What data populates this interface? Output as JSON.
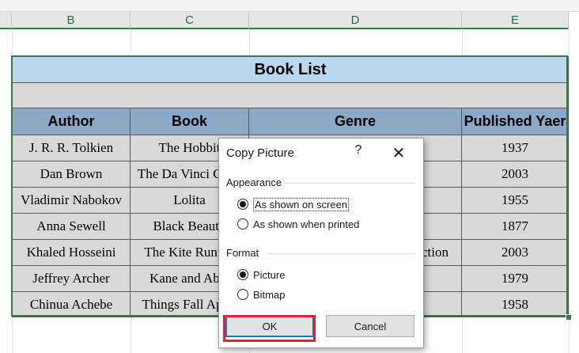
{
  "columns": [
    "B",
    "C",
    "D",
    "E"
  ],
  "table": {
    "title": "Book List",
    "headers": [
      "Author",
      "Book",
      "Genre",
      "Published Yaer"
    ],
    "rows": [
      [
        "J. R. R. Tolkien",
        "The Hobbit",
        "",
        "1937"
      ],
      [
        "Dan Brown",
        "The Da Vinci Code",
        "",
        "2003"
      ],
      [
        "Vladimir Nabokov",
        "Lolita",
        "",
        "1955"
      ],
      [
        "Anna Sewell",
        "Black Beauty",
        "",
        "1877"
      ],
      [
        "Khaled Hosseini",
        "The Kite Runner",
        "ction",
        "2003"
      ],
      [
        "Jeffrey Archer",
        "Kane and Abel",
        "",
        "1979"
      ],
      [
        "Chinua Achebe",
        "Things Fall Apart",
        "",
        "1958"
      ]
    ]
  },
  "dialog": {
    "title": "Copy Picture",
    "help": "?",
    "close": "✕",
    "appearance_label": "Appearance",
    "appearance_options": [
      "As shown on screen",
      "As shown when printed"
    ],
    "appearance_selected": 0,
    "format_label": "Format",
    "format_options": [
      "Picture",
      "Bitmap"
    ],
    "format_selected": 0,
    "ok_label": "OK",
    "cancel_label": "Cancel"
  },
  "colors": {
    "title_fill": "#bdd7ee",
    "header_fill": "#8ea9c8",
    "cell_fill": "#d9d9d9",
    "selection": "#2f7d47",
    "highlight": "#e0252b"
  }
}
